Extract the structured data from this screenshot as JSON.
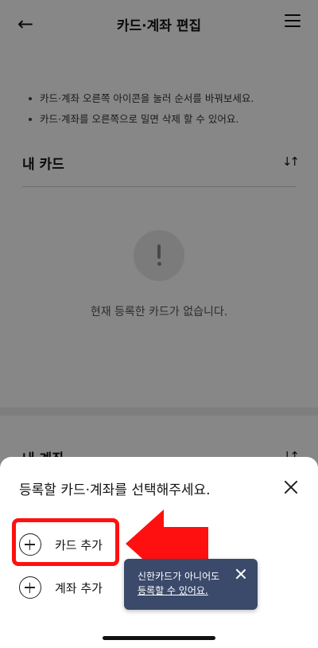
{
  "header": {
    "back_icon": "←",
    "title": "카드·계좌 편집"
  },
  "guide": {
    "items": [
      "카드·계좌 오른쪽 아이콘을 눌러 순서를 바꿔보세요.",
      "카드·계좌를 오른쪽으로 밀면 삭제 할 수 있어요."
    ]
  },
  "my_cards": {
    "title": "내 카드",
    "sort_icon": "↓↑",
    "empty_message": "현재 등록한 카드가 없습니다."
  },
  "my_accounts": {
    "title": "내 계좌",
    "sort_icon": "↓↑"
  },
  "sheet": {
    "title": "등록할 카드·계좌를 선택해주세요.",
    "options": [
      {
        "label": "카드 추가"
      },
      {
        "label": "계좌 추가"
      }
    ]
  },
  "tooltip": {
    "line1": "신한카드가 아니어도",
    "link_text": "등록할 수 있어요."
  },
  "colors": {
    "highlight": "#ff1010",
    "tooltip_bg": "#3b4a6b",
    "overlay": "rgba(0,0,0,0.47)"
  }
}
